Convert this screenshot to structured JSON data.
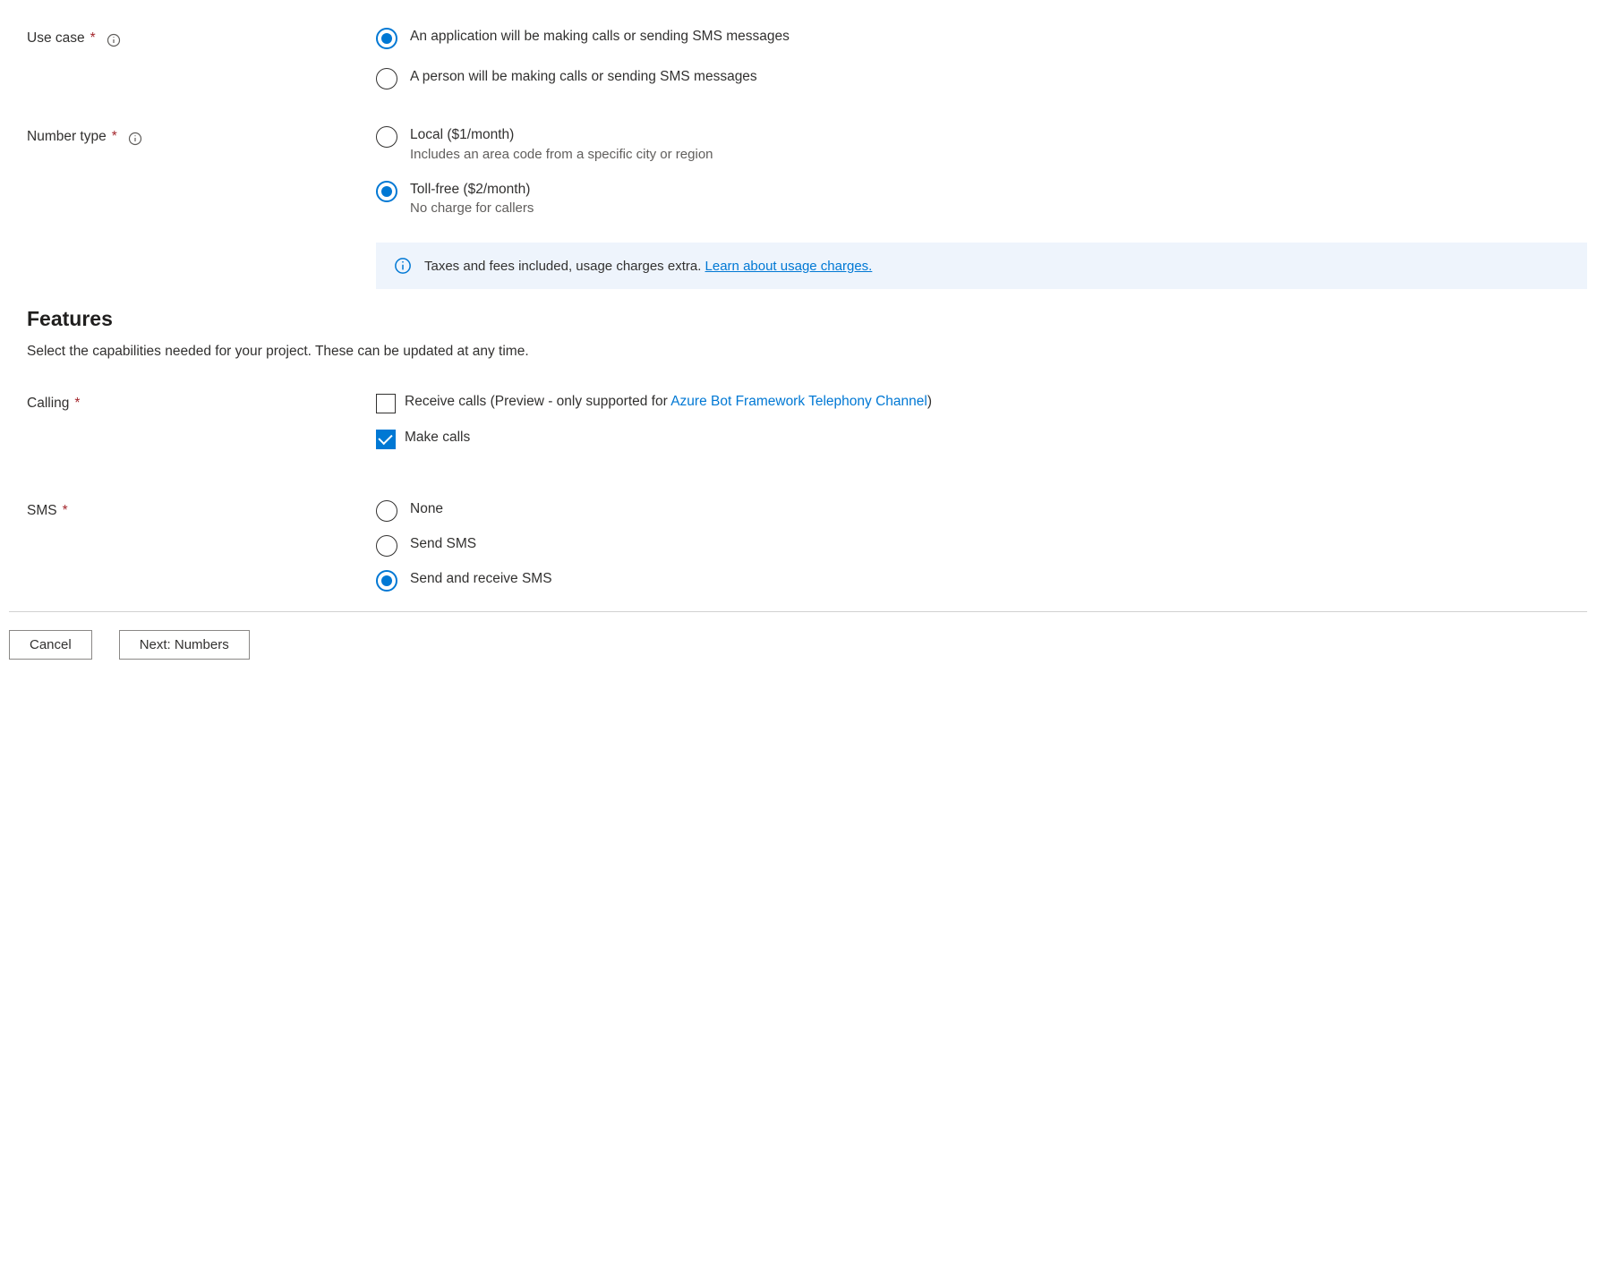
{
  "useCase": {
    "label": "Use case",
    "options": {
      "app": "An application will be making calls or sending SMS messages",
      "person": "A person will be making calls or sending SMS messages"
    }
  },
  "numberType": {
    "label": "Number type",
    "local": {
      "label": "Local ($1/month)",
      "sub": "Includes an area code from a specific city or region"
    },
    "tollfree": {
      "label": "Toll-free ($2/month)",
      "sub": "No charge for callers"
    }
  },
  "infoBox": {
    "text": "Taxes and fees included, usage charges extra. ",
    "linkText": "Learn about usage charges."
  },
  "features": {
    "heading": "Features",
    "desc": "Select the capabilities needed for your project. These can be updated at any time."
  },
  "calling": {
    "label": "Calling",
    "receive": {
      "prefix": "Receive calls (Preview - only supported for ",
      "link": "Azure Bot Framework Telephony Channel",
      "suffix": ")"
    },
    "make": "Make calls"
  },
  "sms": {
    "label": "SMS",
    "none": "None",
    "send": "Send SMS",
    "sendReceive": "Send and receive SMS"
  },
  "buttons": {
    "cancel": "Cancel",
    "next": "Next: Numbers"
  }
}
